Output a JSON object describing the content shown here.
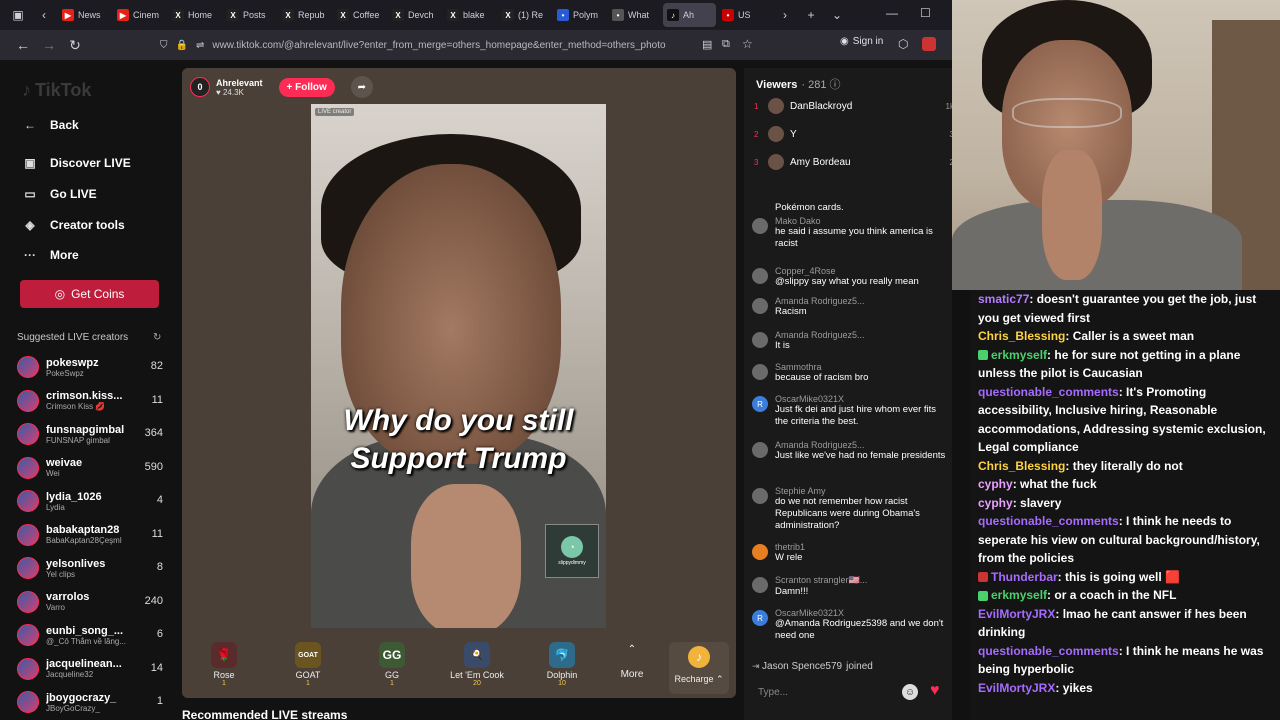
{
  "browser": {
    "tabs": [
      {
        "label": "",
        "icon": "collections-icon",
        "color": "#5b5b66"
      },
      {
        "label": "News",
        "icon": "youtube-icon",
        "color": "#e62117"
      },
      {
        "label": "Cinem",
        "icon": "youtube-icon",
        "color": "#e62117"
      },
      {
        "label": "Home",
        "icon": "x-icon",
        "color": "#222"
      },
      {
        "label": "Posts",
        "icon": "x-icon",
        "color": "#222"
      },
      {
        "label": "Repub",
        "icon": "x-icon",
        "color": "#222"
      },
      {
        "label": "Coffee",
        "icon": "x-icon",
        "color": "#222"
      },
      {
        "label": "Devch",
        "icon": "x-icon",
        "color": "#222"
      },
      {
        "label": "blake",
        "icon": "x-icon",
        "color": "#222"
      },
      {
        "label": "(1) Re",
        "icon": "x-icon",
        "color": "#222"
      },
      {
        "label": "Polym",
        "icon": "polymarket-icon",
        "color": "#2a5bd7"
      },
      {
        "label": "What",
        "icon": "page-icon",
        "color": "#555"
      },
      {
        "label": "Ah",
        "icon": "tiktok-icon",
        "color": "#111"
      },
      {
        "label": "US",
        "icon": "shop-icon",
        "color": "#c00"
      }
    ],
    "url": "www.tiktok.com/@ahrelevant/live?enter_from_merge=others_homepage&enter_method=others_photo",
    "signin": "Sign in"
  },
  "sidebar": {
    "logo": "TikTok",
    "back": "Back",
    "items": [
      {
        "label": "Discover LIVE",
        "icon": "live-icon"
      },
      {
        "label": "Go LIVE",
        "icon": "camera-icon"
      },
      {
        "label": "Creator tools",
        "icon": "lightbulb-icon"
      },
      {
        "label": "More",
        "icon": "more-dots-icon"
      }
    ],
    "get_coins": "Get Coins",
    "suggested_title": "Suggested LIVE creators",
    "creators": [
      {
        "name": "pokeswpz",
        "sub": "PokeSwpz",
        "count": "82"
      },
      {
        "name": "crimson.kiss...",
        "sub": "Crimson Kiss 💋",
        "count": "11"
      },
      {
        "name": "funsnapgimbal",
        "sub": "FUNSNAP gimbal",
        "count": "364"
      },
      {
        "name": "weivae",
        "sub": "Wei",
        "count": "590"
      },
      {
        "name": "lydia_1026",
        "sub": "Lydia",
        "count": "4"
      },
      {
        "name": "babakaptan28",
        "sub": "BabaKaptan28Çeşml",
        "count": "11"
      },
      {
        "name": "yelsonlives",
        "sub": "Yel clips",
        "count": "8"
      },
      {
        "name": "varrolos",
        "sub": "Varro",
        "count": "240"
      },
      {
        "name": "eunbi_song_...",
        "sub": "@_Cô Thắm về lăng...",
        "count": "6"
      },
      {
        "name": "jacquelinean...",
        "sub": "Jacqueline32",
        "count": "14"
      },
      {
        "name": "jboygocrazy_",
        "sub": "JBoyGoCrazy_",
        "count": "1"
      }
    ]
  },
  "video": {
    "host_rank": "0",
    "host_name": "Ahrelevant",
    "host_likes": "♥ 24.3K",
    "follow": "+ Follow",
    "caption_line1": "Why do you  still",
    "caption_line2": "Support Trump",
    "live_tag": "LIVE creator",
    "pip_name": "slippydimmy"
  },
  "gifts": [
    {
      "name": "Rose",
      "price": "1",
      "glyph": "🌹",
      "color": "#5a2b2b"
    },
    {
      "name": "GOAT",
      "price": "1",
      "glyph": "GOAT",
      "color": "#6a5420"
    },
    {
      "name": "GG",
      "price": "1",
      "glyph": "GG",
      "color": "#3d5a34"
    },
    {
      "name": "Let 'Em Cook",
      "price": "20",
      "glyph": "🍳",
      "color": "#3a4b6a"
    },
    {
      "name": "Dolphin",
      "price": "10",
      "glyph": "🐬",
      "color": "#2e6a8a"
    }
  ],
  "gift_more": "More",
  "recharge": "Recharge ⌃",
  "recommended": "Recommended LIVE streams",
  "viewers": {
    "title": "Viewers",
    "count": "· 281 ⓘ",
    "list": [
      {
        "rank": "1",
        "name": "DanBlackroyd",
        "coins": "1k"
      },
      {
        "rank": "2",
        "name": "Y",
        "coins": "3"
      },
      {
        "rank": "3",
        "name": "Amy Bordeau",
        "coins": "2"
      }
    ]
  },
  "chat": {
    "partial": "Pokémon cards.",
    "messages": [
      {
        "user": "Mako Dako",
        "text": "he said i assume you think america is racist"
      },
      {
        "user": "Copper_4Rose",
        "text": "@slippy say what you really mean"
      },
      {
        "user": "Amanda Rodriguez5...",
        "text": "Racism"
      },
      {
        "user": "Amanda Rodriguez5...",
        "text": "It is"
      },
      {
        "user": "Sammothra",
        "text": "because of racism bro"
      },
      {
        "user": "OscarMike0321X",
        "text": "Just fk dei and just hire whom ever fits the criteria the best."
      },
      {
        "user": "Amanda Rodriguez5...",
        "text": "Just like we've had no female presidents"
      },
      {
        "user": "Stephie Amy",
        "text": "do we not remember how racist Republicans were during Obama's administration?"
      },
      {
        "user": "thetrib1",
        "text": "W rele"
      },
      {
        "user": "Scranton strangler🇺🇸...",
        "text": "Damn!!!"
      },
      {
        "user": "OscarMike0321X",
        "text": "@Amanda Rodriguez5398 and we don't need one"
      }
    ],
    "joined_user": "Jason Spence579",
    "joined_label": "joined",
    "input_placeholder": "Type..."
  },
  "stream_chat": [
    {
      "user": "smatic77",
      "color": "#b57bff",
      "text": ": doesn't guarantee you get the job, just you get viewed first"
    },
    {
      "user": "Chris_Blessing",
      "color": "#ffd23f",
      "text": ": Caller is a sweet man"
    },
    {
      "user": "erkmyself",
      "color": "#4bd16b",
      "text": ": he for sure not getting in a plane unless the pilot is Caucasian",
      "badge": true
    },
    {
      "user": "questionable_comments",
      "color": "#a66bff",
      "text": ": It's Promoting accessibility, Inclusive hiring, Reasonable accommodations, Addressing systemic exclusion, Legal compliance"
    },
    {
      "user": "Chris_Blessing",
      "color": "#ffd23f",
      "text": ": they literally do not"
    },
    {
      "user": "cyphy",
      "color": "#e8a0ff",
      "text": ": what the fuck"
    },
    {
      "user": "cyphy",
      "color": "#e8a0ff",
      "text": ": slavery"
    },
    {
      "user": "questionable_comments",
      "color": "#a66bff",
      "text": ": I think he needs to seperate his view on cultural background/history, from the policies"
    },
    {
      "user": "Thunderbar",
      "color": "#a66bff",
      "text": ": this is going well 🟥",
      "badge": true
    },
    {
      "user": "erkmyself",
      "color": "#4bd16b",
      "text": ": or a coach in the NFL",
      "badge": true
    },
    {
      "user": "EvilMortyJRX",
      "color": "#a66bff",
      "text": ": lmao he cant answer if hes been drinking"
    },
    {
      "user": "questionable_comments",
      "color": "#a66bff",
      "text": ": I think he means he was being hyperbolic"
    },
    {
      "user": "EvilMortyJRX",
      "color": "#a66bff",
      "text": ": yikes"
    }
  ]
}
